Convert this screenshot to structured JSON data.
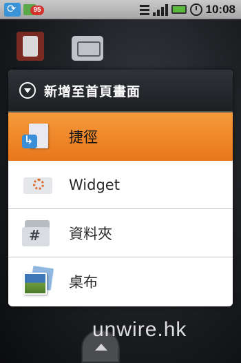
{
  "status_bar": {
    "notification_badge": "95",
    "time": "10:08",
    "icons": [
      "sync-icon",
      "notification-icon",
      "wifi-icon",
      "signal-icon",
      "battery-icon",
      "alarm-icon"
    ]
  },
  "dialog": {
    "title": "新增至首頁畫面",
    "items": [
      {
        "label": "捷徑",
        "icon": "shortcut-icon",
        "selected": true
      },
      {
        "label": "Widget",
        "icon": "widget-icon",
        "selected": false
      },
      {
        "label": "資料夾",
        "icon": "folder-icon",
        "selected": false
      },
      {
        "label": "桌布",
        "icon": "wallpaper-icon",
        "selected": false
      }
    ],
    "selected_color": "#f0852a"
  },
  "watermark": "unwire.hk"
}
